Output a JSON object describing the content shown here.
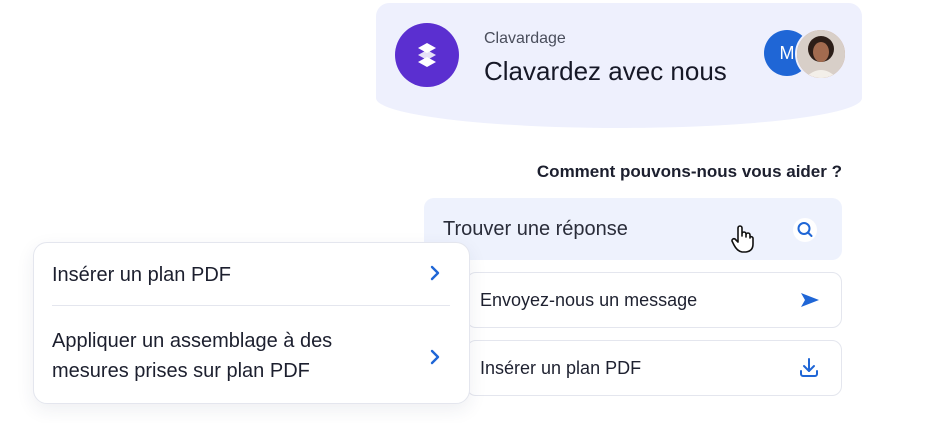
{
  "header": {
    "subtitle": "Clavardage",
    "title": "Clavardez avec nous",
    "agent_initial": "M"
  },
  "prompt": "Comment pouvons-nous vous aider ?",
  "search": {
    "label": "Trouver une réponse"
  },
  "options": [
    {
      "label": "Envoyez-nous un message",
      "icon": "send-icon"
    },
    {
      "label": "Insérer un plan PDF",
      "icon": "download-icon"
    }
  ],
  "popup": {
    "items": [
      {
        "label": "Insérer un plan PDF"
      },
      {
        "label_line1": "Appliquer un assemblage à des",
        "label_line2": "mesures prises sur plan PDF"
      }
    ]
  },
  "colors": {
    "brand": "#5b2fd0",
    "accent": "#1f66d6",
    "header_bg": "#eef0fd"
  }
}
